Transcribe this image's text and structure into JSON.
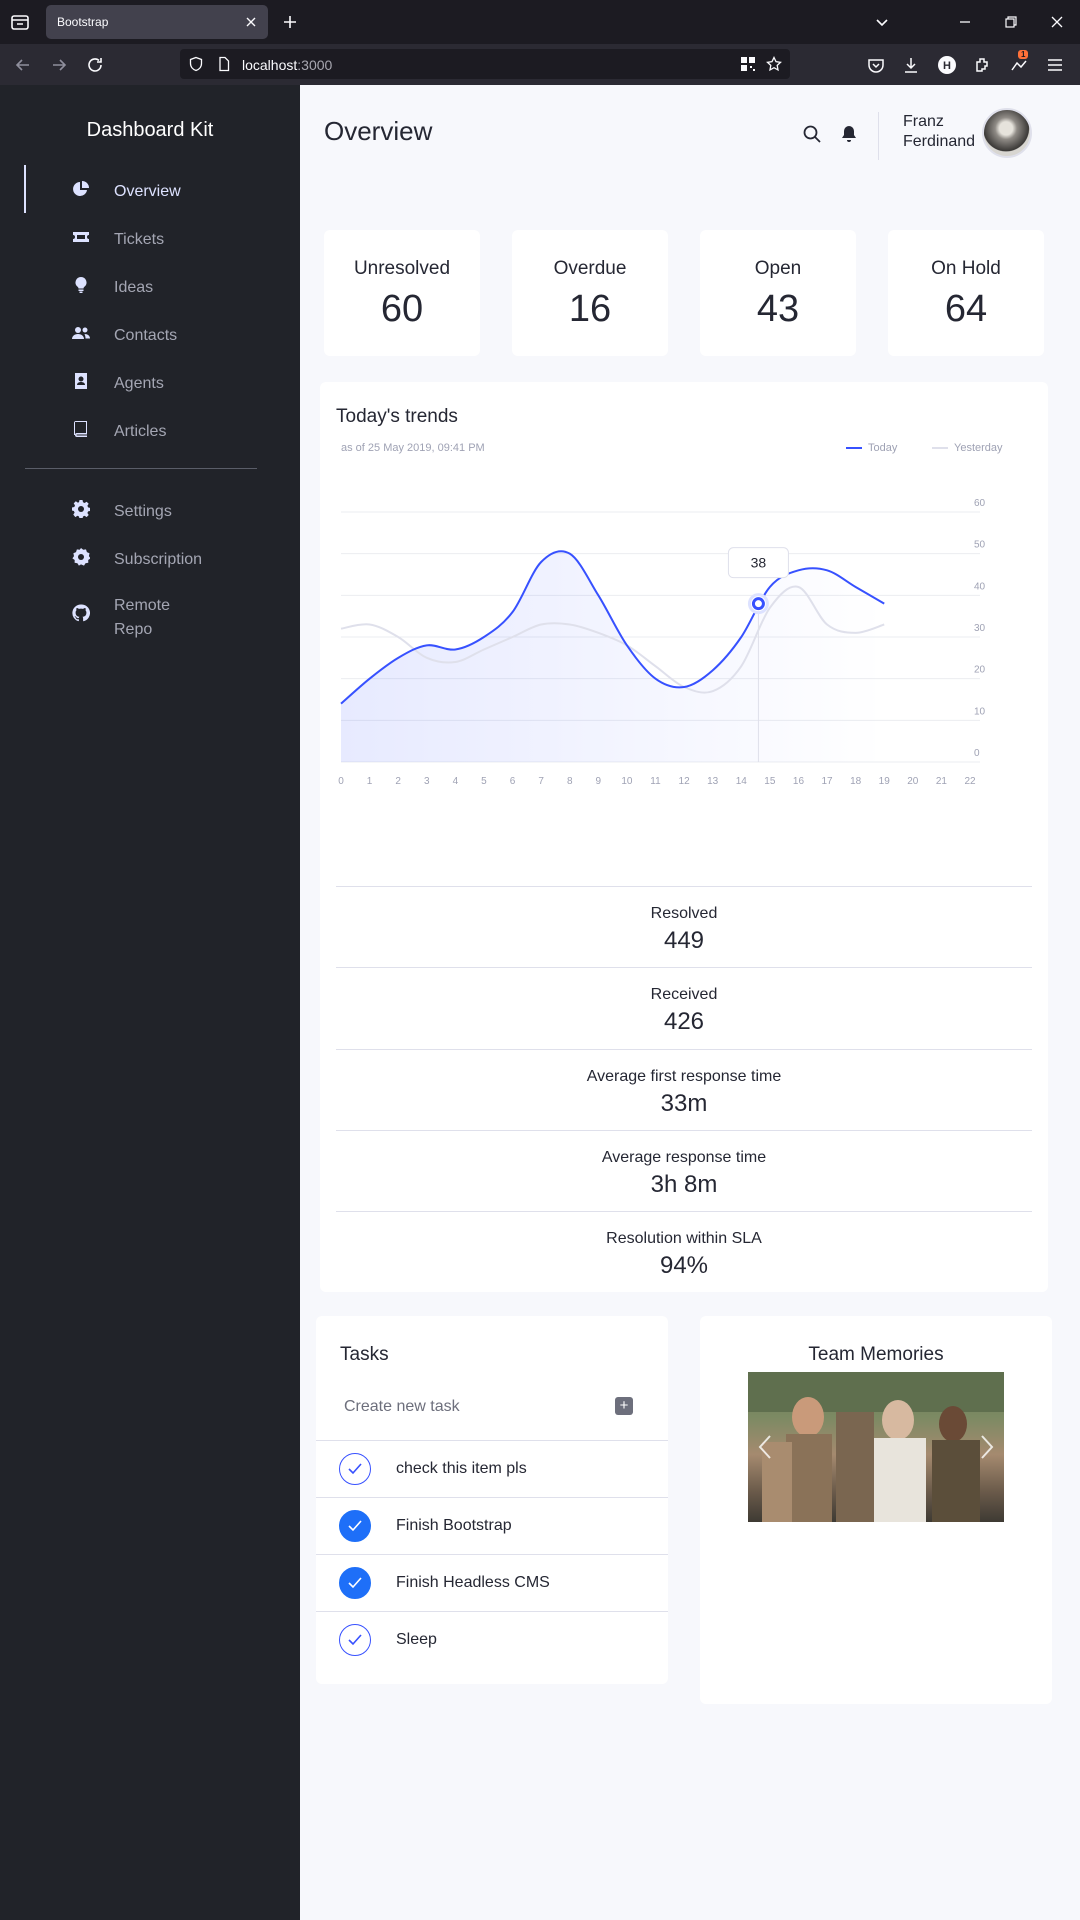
{
  "browser": {
    "tab_title": "Bootstrap",
    "url_host": "localhost",
    "url_port": ":3000",
    "download_badge": "1"
  },
  "sidebar": {
    "brand": "Dashboard Kit",
    "items": [
      {
        "label": "Overview",
        "icon": "pie-chart-icon",
        "active": true
      },
      {
        "label": "Tickets",
        "icon": "ticket-icon"
      },
      {
        "label": "Ideas",
        "icon": "lightbulb-icon"
      },
      {
        "label": "Contacts",
        "icon": "users-icon"
      },
      {
        "label": "Agents",
        "icon": "id-badge-icon"
      },
      {
        "label": "Articles",
        "icon": "book-icon"
      }
    ],
    "secondary": [
      {
        "label": "Settings",
        "icon": "gear-icon"
      },
      {
        "label": "Subscription",
        "icon": "badge-icon"
      },
      {
        "label": "Remote",
        "label2": "Repo",
        "icon": "github-icon"
      }
    ]
  },
  "header": {
    "title": "Overview",
    "user_first": "Franz",
    "user_last": "Ferdinand"
  },
  "stats": [
    {
      "label": "Unresolved",
      "value": "60"
    },
    {
      "label": "Overdue",
      "value": "16"
    },
    {
      "label": "Open",
      "value": "43"
    },
    {
      "label": "On Hold",
      "value": "64"
    }
  ],
  "trends": {
    "title": "Today's trends",
    "subtitle": "as of 25 May 2019, 09:41 PM",
    "legend_today": "Today",
    "legend_yesterday": "Yesterday",
    "tooltip_value": "38"
  },
  "chart_data": {
    "type": "line",
    "title": "Today's trends",
    "x": [
      0,
      1,
      2,
      3,
      4,
      5,
      6,
      7,
      8,
      9,
      10,
      11,
      12,
      13,
      14,
      15,
      16,
      17,
      18,
      19,
      20,
      21,
      22
    ],
    "yticks": [
      0,
      10,
      20,
      30,
      40,
      50,
      60
    ],
    "ylim": [
      0,
      60
    ],
    "xlim": [
      0,
      22
    ],
    "grid": true,
    "legend": "top-right",
    "series": [
      {
        "name": "Today",
        "color": "#3751ff",
        "points": [
          [
            0,
            14
          ],
          [
            1,
            20
          ],
          [
            2,
            25
          ],
          [
            3,
            28
          ],
          [
            4,
            27
          ],
          [
            5,
            30
          ],
          [
            6,
            36
          ],
          [
            7,
            48
          ],
          [
            8,
            50
          ],
          [
            9,
            40
          ],
          [
            10,
            28
          ],
          [
            11,
            20
          ],
          [
            12,
            18
          ],
          [
            13,
            22
          ],
          [
            14,
            30
          ],
          [
            15,
            42
          ],
          [
            16,
            46
          ],
          [
            17,
            46
          ],
          [
            18,
            42
          ],
          [
            19,
            38
          ]
        ]
      },
      {
        "name": "Yesterday",
        "color": "#dfe0eb",
        "points": [
          [
            0,
            32
          ],
          [
            1,
            33
          ],
          [
            2,
            30
          ],
          [
            3,
            25
          ],
          [
            4,
            24
          ],
          [
            5,
            27
          ],
          [
            6,
            30
          ],
          [
            7,
            33
          ],
          [
            8,
            33
          ],
          [
            9,
            31
          ],
          [
            10,
            28
          ],
          [
            11,
            23
          ],
          [
            12,
            18
          ],
          [
            13,
            17
          ],
          [
            14,
            23
          ],
          [
            15,
            37
          ],
          [
            16,
            42
          ],
          [
            17,
            33
          ],
          [
            18,
            31
          ],
          [
            19,
            33
          ]
        ]
      }
    ],
    "tooltip": {
      "x": 14.6,
      "y": 38,
      "label": "38"
    }
  },
  "metrics": [
    {
      "label": "Resolved",
      "value": "449"
    },
    {
      "label": "Received",
      "value": "426"
    },
    {
      "label": "Average first response time",
      "value": "33m"
    },
    {
      "label": "Average response time",
      "value": "3h 8m"
    },
    {
      "label": "Resolution within SLA",
      "value": "94%"
    }
  ],
  "tasks": {
    "title": "Tasks",
    "new_placeholder": "Create new task",
    "items": [
      {
        "label": "check this item pls",
        "done": false
      },
      {
        "label": "Finish Bootstrap",
        "done": true
      },
      {
        "label": "Finish Headless CMS",
        "done": true
      },
      {
        "label": "Sleep",
        "done": false
      }
    ]
  },
  "memories": {
    "title": "Team Memories"
  }
}
